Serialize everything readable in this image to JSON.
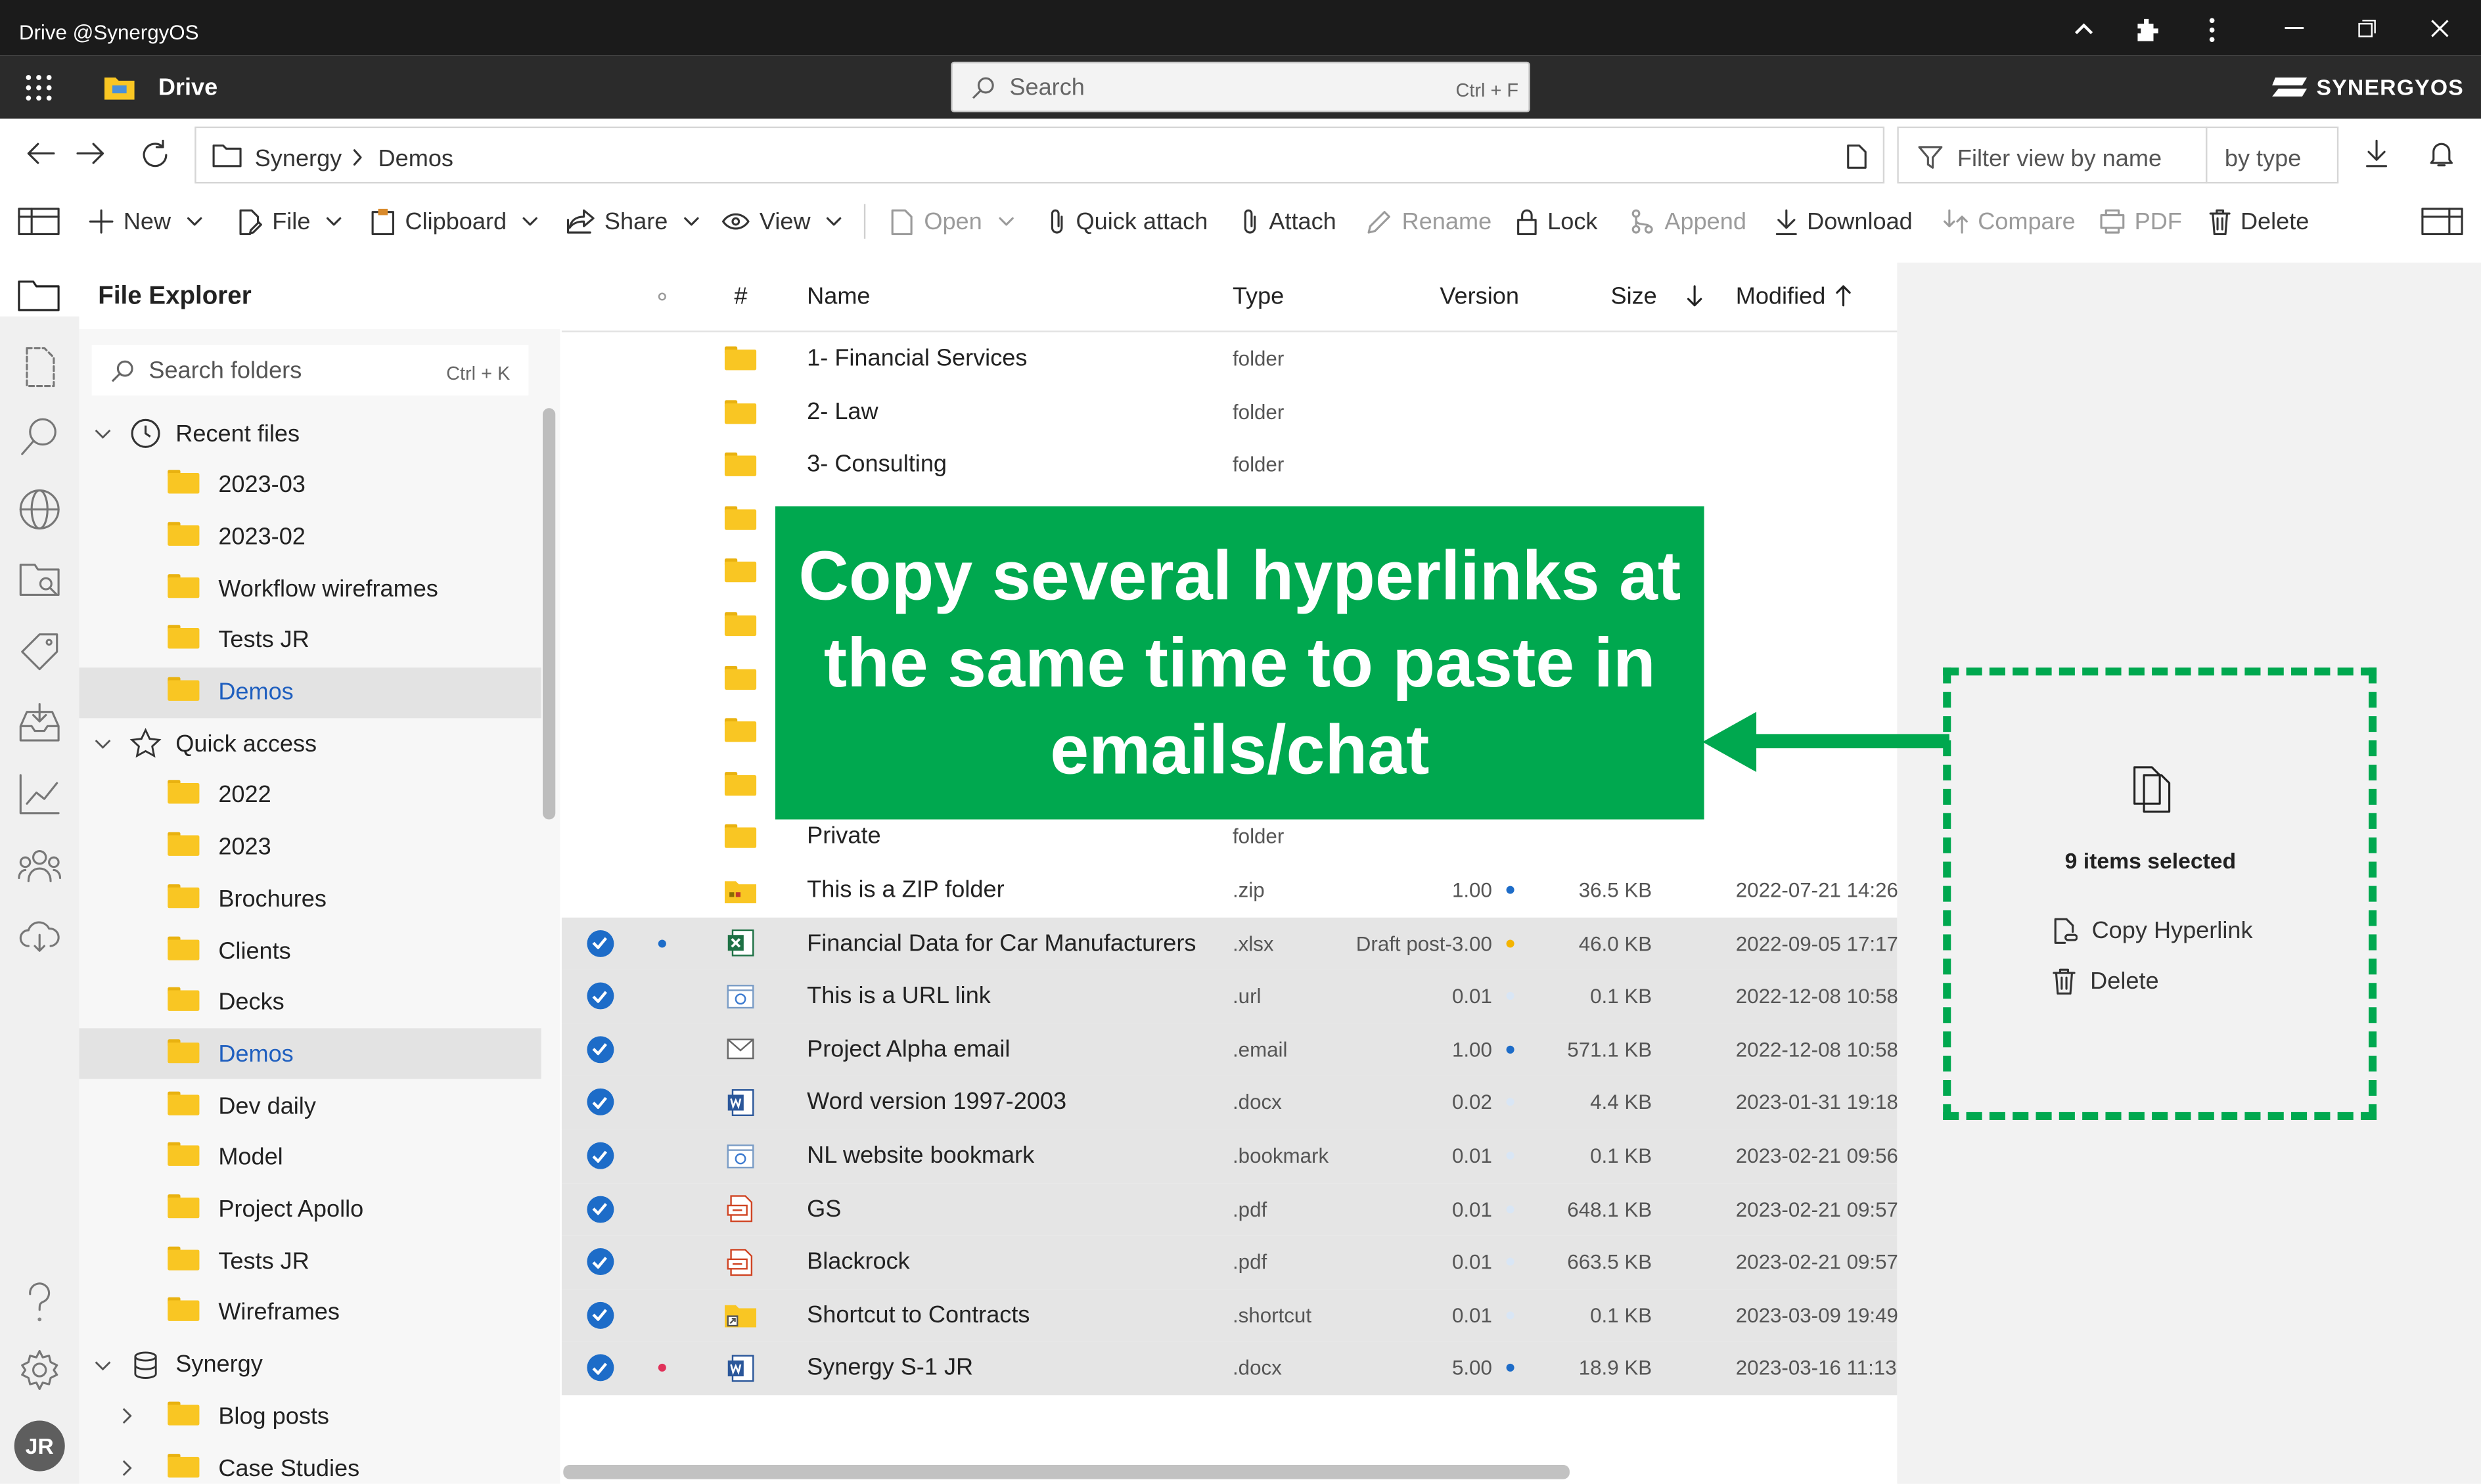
{
  "window": {
    "title": "Drive @SynergyOS"
  },
  "app": {
    "name": "Drive",
    "brand": "SYNERGYOS",
    "search_placeholder": "Search",
    "search_shortcut": "Ctrl + F"
  },
  "breadcrumb": [
    "Synergy",
    "Demos"
  ],
  "filter": {
    "placeholder": "Filter view by name",
    "sort_label": "by type"
  },
  "toolbar": {
    "new": "New",
    "file": "File",
    "clipboard": "Clipboard",
    "share": "Share",
    "view": "View",
    "open": "Open",
    "quick_attach": "Quick attach",
    "attach": "Attach",
    "rename": "Rename",
    "lock": "Lock",
    "append": "Append",
    "download": "Download",
    "compare": "Compare",
    "pdf": "PDF",
    "delete": "Delete"
  },
  "explorer": {
    "title": "File Explorer",
    "search_placeholder": "Search folders",
    "search_shortcut": "Ctrl + K",
    "recent_label": "Recent files",
    "recent": [
      "2023-03",
      "2023-02",
      "Workflow wireframes",
      "Tests JR",
      "Demos"
    ],
    "quick_label": "Quick access",
    "quick": [
      "2022",
      "2023",
      "Brochures",
      "Clients",
      "Decks",
      "Demos",
      "Dev daily",
      "Model",
      "Project Apollo",
      "Tests JR",
      "Wireframes"
    ],
    "synergy_label": "Synergy",
    "synergy": [
      "Blog posts",
      "Case Studies"
    ]
  },
  "user": {
    "initials": "JR"
  },
  "table": {
    "columns": {
      "hash": "#",
      "name": "Name",
      "type": "Type",
      "version": "Version",
      "size": "Size",
      "modified": "Modified"
    },
    "rows": [
      {
        "name": "1- Financial Services",
        "type": "folder",
        "icon": "folder-icon"
      },
      {
        "name": "2- Law",
        "type": "folder",
        "icon": "folder-icon"
      },
      {
        "name": "3- Consulting",
        "type": "folder",
        "icon": "folder-icon"
      },
      {
        "name": "",
        "type": "",
        "icon": "folder-icon"
      },
      {
        "name": "",
        "type": "",
        "icon": "folder-icon"
      },
      {
        "name": "",
        "type": "",
        "icon": "folder-icon"
      },
      {
        "name": "",
        "type": "",
        "icon": "folder-icon"
      },
      {
        "name": "",
        "type": "",
        "icon": "folder-icon"
      },
      {
        "name": "",
        "type": "",
        "icon": "folder-icon"
      },
      {
        "name": "Private",
        "type": "folder",
        "icon": "folder-icon"
      },
      {
        "name": "This is a ZIP folder",
        "type": ".zip",
        "version": "1.00",
        "vdot": "#1d6cc8",
        "size": "36.5 KB",
        "modified": "2022-07-21 14:26",
        "icon": "zip-icon"
      },
      {
        "name": "Financial Data for Car Manufacturers",
        "type": ".xlsx",
        "version": "Draft post-3.00",
        "vdot": "#f4b400",
        "size": "46.0 KB",
        "modified": "2022-09-05 17:17",
        "icon": "excel-icon",
        "selected": true,
        "mark": "#1d6cc8"
      },
      {
        "name": "This is a URL link",
        "type": ".url",
        "version": "0.01",
        "vdot": "#d9e6f5",
        "size": "0.1 KB",
        "modified": "2022-12-08 10:58",
        "icon": "link-icon",
        "selected": true
      },
      {
        "name": "Project Alpha email",
        "type": ".email",
        "version": "1.00",
        "vdot": "#1d6cc8",
        "size": "571.1 KB",
        "modified": "2022-12-08 10:58",
        "icon": "email-icon",
        "selected": true
      },
      {
        "name": "Word version 1997-2003",
        "type": ".docx",
        "version": "0.02",
        "vdot": "#d9e6f5",
        "size": "4.4 KB",
        "modified": "2023-01-31 19:18",
        "icon": "word-icon",
        "selected": true
      },
      {
        "name": "NL website bookmark",
        "type": ".bookmark",
        "version": "0.01",
        "vdot": "#d9e6f5",
        "size": "0.1 KB",
        "modified": "2023-02-21 09:56",
        "icon": "bookmark-icon",
        "selected": true
      },
      {
        "name": "GS",
        "type": ".pdf",
        "version": "0.01",
        "vdot": "#d9e6f5",
        "size": "648.1 KB",
        "modified": "2023-02-21 09:57",
        "icon": "pdf-icon",
        "selected": true
      },
      {
        "name": "Blackrock",
        "type": ".pdf",
        "version": "0.01",
        "vdot": "#d9e6f5",
        "size": "663.5 KB",
        "modified": "2023-02-21 09:57",
        "icon": "pdf-icon",
        "selected": true
      },
      {
        "name": "Shortcut to Contracts",
        "type": ".shortcut",
        "version": "0.01",
        "vdot": "#d9e6f5",
        "size": "0.1 KB",
        "modified": "2023-03-09 19:49",
        "icon": "shortcut-icon",
        "selected": true
      },
      {
        "name": "Synergy S-1 JR",
        "type": ".docx",
        "version": "5.00",
        "vdot": "#1d6cc8",
        "size": "18.9 KB",
        "modified": "2023-03-16 11:13",
        "icon": "word-icon",
        "selected": true,
        "mark": "#e0325a"
      }
    ]
  },
  "selection": {
    "count_label": "9 items selected",
    "copy_hyperlink": "Copy Hyperlink",
    "delete": "Delete"
  },
  "callout": {
    "text": "Copy several hyperlinks at the same time to paste in emails/chat",
    "color": "#00a84f"
  }
}
